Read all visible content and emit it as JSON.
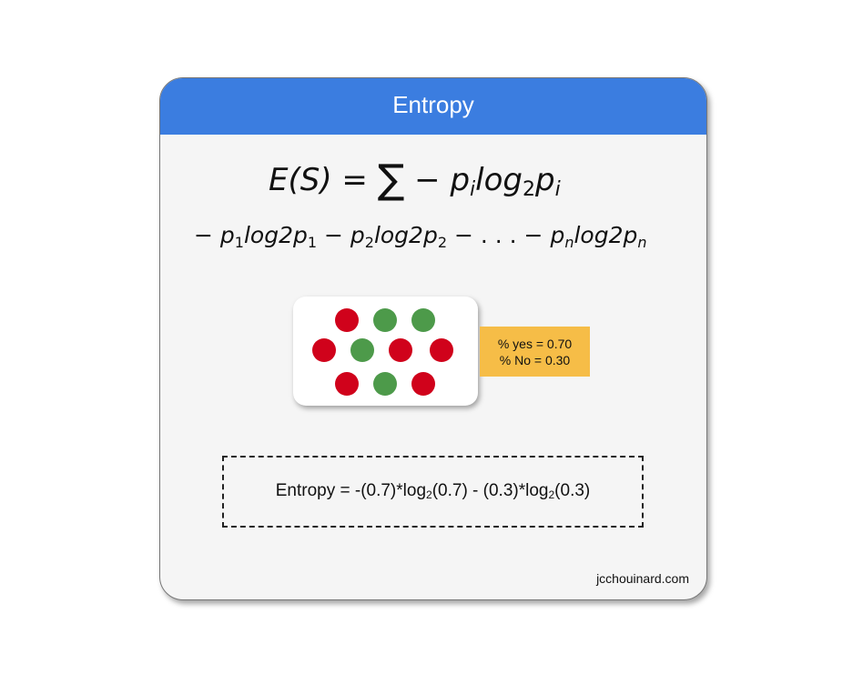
{
  "title": "Entropy",
  "formula_main": {
    "lhs": "E(S) = ",
    "sigma": "∑",
    "term_start": " − p",
    "sub_i": "i",
    "log": "log",
    "sub_2": "2",
    "p": "p",
    "sub_i2": "i"
  },
  "formula_expanded": {
    "t1_pre": "− p",
    "t1_sub": "1",
    "t1_mid": "log2p",
    "t1_sub2": "1",
    "t2_pre": " − p",
    "t2_sub": "2",
    "t2_mid": "log2p",
    "t2_sub2": "2",
    "ellipsis": " − . . . ",
    "tn_pre": "− p",
    "tn_sub": "n",
    "tn_mid": "log2p",
    "tn_sub2": "n"
  },
  "sample": {
    "dots": [
      {
        "color": "red"
      },
      {
        "color": "green"
      },
      {
        "color": "green"
      },
      {
        "color": "red"
      },
      {
        "color": "green"
      },
      {
        "color": "red"
      },
      {
        "color": "red"
      },
      {
        "color": "red"
      },
      {
        "color": "green"
      },
      {
        "color": "red"
      }
    ],
    "colors": {
      "red": "#d0021b",
      "green": "#4d9a4a"
    }
  },
  "stats": {
    "yes": "% yes = 0.70",
    "no": "% No = 0.30"
  },
  "equation": {
    "part1": "Entropy = -(0.7)*log",
    "sub1": "2",
    "part2": "(0.7) - (0.3)*log",
    "sub2": "2",
    "part3": "(0.3)"
  },
  "credit": "jcchouinard.com",
  "colors": {
    "header": "#3b7de0",
    "card": "#f5f5f5",
    "callout": "#f6bd47"
  }
}
